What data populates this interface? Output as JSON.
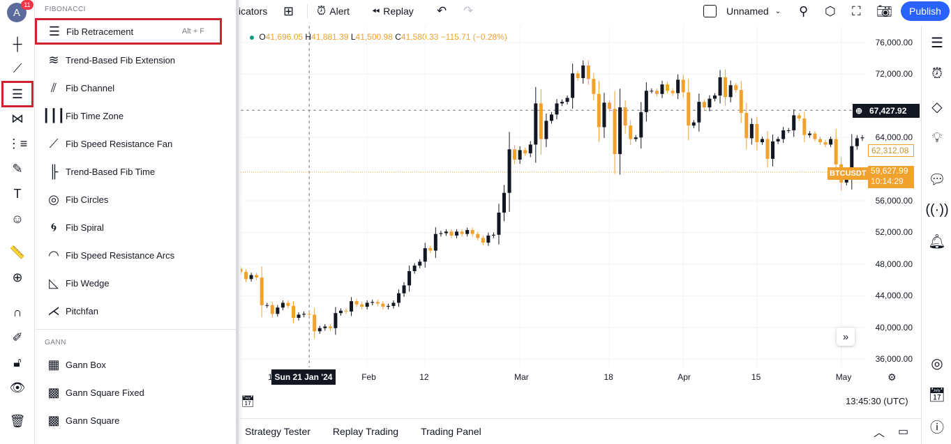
{
  "header": {
    "avatar_letter": "A",
    "notif_count": "11",
    "indicators_label": "icators",
    "alert_label": "Alert",
    "replay_label": "Replay",
    "layout_name": "Unnamed",
    "publish_label": "Publish"
  },
  "menu": {
    "fib_title": "FIBONACCI",
    "fib_items": [
      {
        "label": "Fib Retracement",
        "shortcut": "Alt + F",
        "icon": "fib-retracement-icon"
      },
      {
        "label": "Trend-Based Fib Extension",
        "icon": "fib-extension-icon"
      },
      {
        "label": "Fib Channel",
        "icon": "fib-channel-icon"
      },
      {
        "label": "Fib Time Zone",
        "icon": "fib-time-zone-icon"
      },
      {
        "label": "Fib Speed Resistance Fan",
        "icon": "fib-fan-icon"
      },
      {
        "label": "Trend-Based Fib Time",
        "icon": "fib-time-icon"
      },
      {
        "label": "Fib Circles",
        "icon": "fib-circles-icon"
      },
      {
        "label": "Fib Spiral",
        "icon": "fib-spiral-icon"
      },
      {
        "label": "Fib Speed Resistance Arcs",
        "icon": "fib-arcs-icon"
      },
      {
        "label": "Fib Wedge",
        "icon": "fib-wedge-icon"
      },
      {
        "label": "Pitchfan",
        "icon": "pitchfan-icon"
      }
    ],
    "gann_title": "GANN",
    "gann_items": [
      {
        "label": "Gann Box",
        "icon": "gann-box-icon"
      },
      {
        "label": "Gann Square Fixed",
        "icon": "gann-square-fixed-icon"
      },
      {
        "label": "Gann Square",
        "icon": "gann-square-icon"
      }
    ]
  },
  "ohlc": {
    "o_label": "O",
    "o": "41,696.05",
    "h_label": "H",
    "h": "41,881.39",
    "l_label": "L",
    "l": "41,500.98",
    "c_label": "C",
    "c": "41,580.33",
    "change": "−115.71 (−0.28%)"
  },
  "price_axis": {
    "ticks": [
      "76,000.00",
      "72,000.00",
      "64,000.00",
      "56,000.00",
      "52,000.00",
      "48,000.00",
      "44,000.00",
      "40,000.00",
      "36,000.00"
    ],
    "crosshair_price": "67,427.92",
    "last_price": "62,312.08",
    "symbol": "BTCUSDT",
    "symbol_price": "59,627.99",
    "countdown": "10:14:29"
  },
  "time_axis": {
    "crosshair_date": "Sun 21 Jan '24",
    "ticks": [
      "Feb",
      "12",
      "Mar",
      "18",
      "Apr",
      "15",
      "May"
    ],
    "left_partial": "1"
  },
  "clock": "13:45:30 (UTC)",
  "bottom_tabs": [
    "Strategy Tester",
    "Replay Trading",
    "Trading Panel"
  ],
  "colors": {
    "up": "#131722",
    "down": "#f0a12e",
    "accent": "#2962ff",
    "highlight": "#d0212f"
  },
  "chart_data": {
    "type": "candlestick",
    "symbol": "BTCUSDT",
    "x_start": "2024-01-08",
    "interval": "1D",
    "ylim": [
      35000,
      77000
    ],
    "closes": [
      47000,
      46100,
      46600,
      46300,
      42800,
      42800,
      41700,
      42500,
      43100,
      42700,
      41200,
      41600,
      41700,
      41600,
      39500,
      39900,
      40100,
      39900,
      41800,
      42100,
      42000,
      43300,
      42900,
      42600,
      43100,
      43200,
      43000,
      42600,
      42700,
      43100,
      44300,
      45300,
      47100,
      47800,
      48300,
      50000,
      49700,
      51800,
      51900,
      52100,
      51600,
      52100,
      51800,
      52300,
      51800,
      51300,
      50700,
      51600,
      51700,
      54500,
      57000,
      62500,
      61200,
      62400,
      62000,
      63100,
      68300,
      63800,
      66100,
      66900,
      68300,
      68500,
      69000,
      72100,
      71500,
      73100,
      71400,
      69500,
      65300,
      68400,
      67600,
      61900,
      67800,
      65500,
      63800,
      64000,
      67200,
      69900,
      69900,
      69500,
      70700,
      69900,
      69600,
      71300,
      69700,
      65500,
      65900,
      68500,
      67800,
      68900,
      69300,
      71600,
      69100,
      70600,
      70000,
      67100,
      63900,
      65700,
      63400,
      63800,
      61300,
      63500,
      63800,
      64900,
      64900,
      66800,
      66400,
      64300,
      64500,
      63800,
      63400,
      63100,
      63800,
      60600,
      58300,
      59100,
      62900,
      63900,
      64000,
      63200,
      62312
    ]
  }
}
